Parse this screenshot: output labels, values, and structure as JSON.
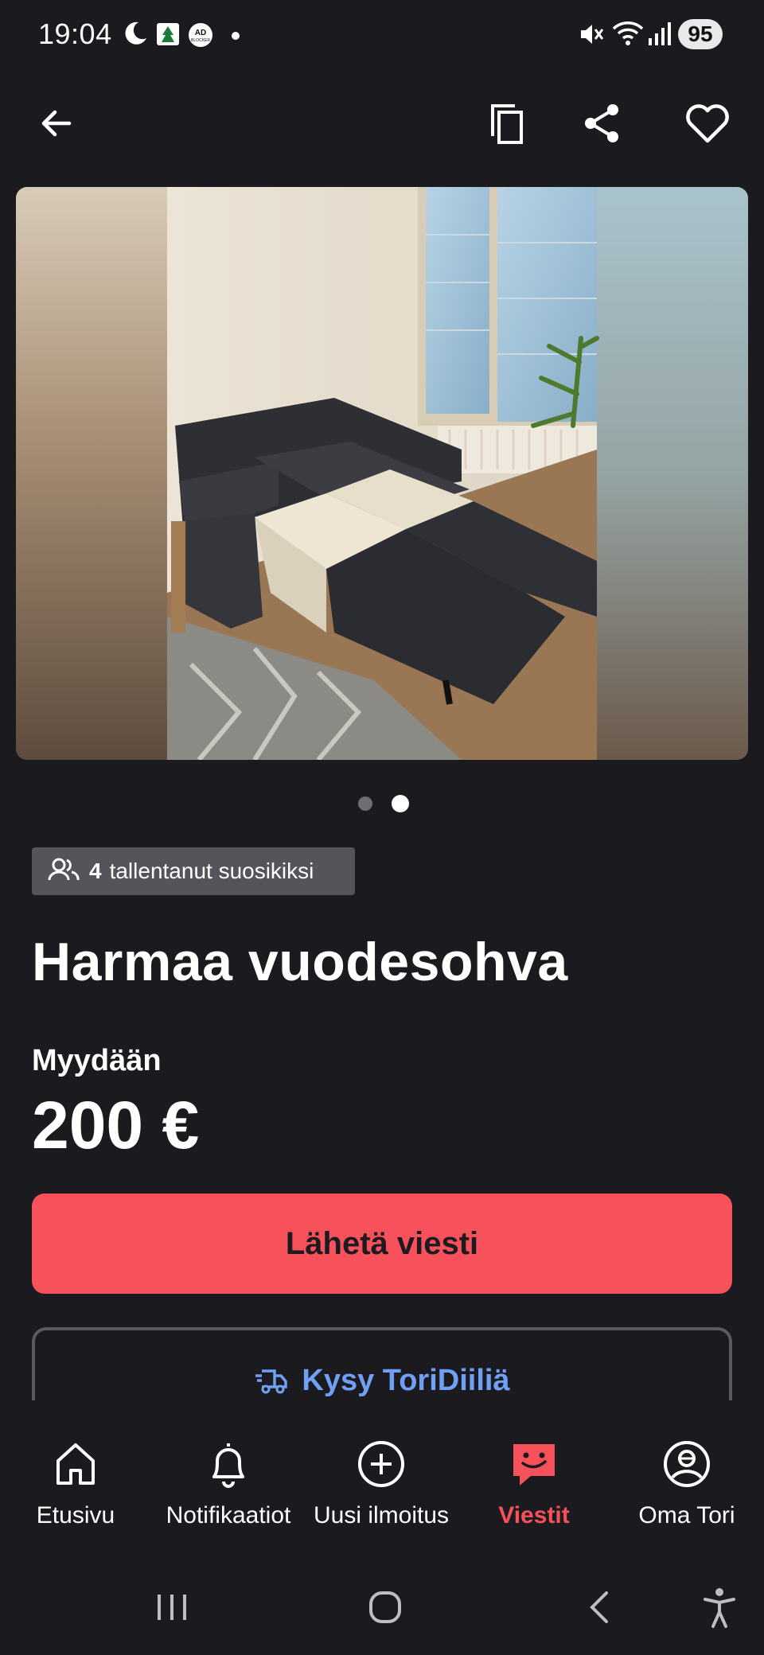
{
  "status_bar": {
    "time": "19:04",
    "battery": "95",
    "icons": [
      "moon-icon",
      "app-notification-icon",
      "adblocker-icon",
      "dot-icon",
      "mute-icon",
      "wifi-icon",
      "signal-icon"
    ]
  },
  "app_bar": {
    "icons": [
      "back-arrow-icon",
      "copy-icon",
      "share-icon",
      "heart-icon"
    ]
  },
  "gallery": {
    "image_count": 2,
    "current_index": 2,
    "image_description_icon": "photo"
  },
  "favorites": {
    "count": "4",
    "label": "tallentanut suosikiksi"
  },
  "listing": {
    "title": "Harmaa vuodesohva",
    "trade_type": "Myydään",
    "price": "200 €"
  },
  "actions": {
    "send_message": "Lähetä viesti",
    "ask_deal": "Kysy ToriDiiliä"
  },
  "bottom_nav": {
    "items": [
      {
        "label": "Etusivu",
        "icon": "home-icon"
      },
      {
        "label": "Notifikaatiot",
        "icon": "bell-icon"
      },
      {
        "label": "Uusi ilmoitus",
        "icon": "plus-circle-icon"
      },
      {
        "label": "Viestit",
        "icon": "chat-icon",
        "active": true
      },
      {
        "label": "Oma Tori",
        "icon": "profile-icon"
      }
    ]
  },
  "colors": {
    "background": "#1b1a1f",
    "accent": "#f7525c",
    "link": "#6fa0f5",
    "badge": "#54545a"
  }
}
